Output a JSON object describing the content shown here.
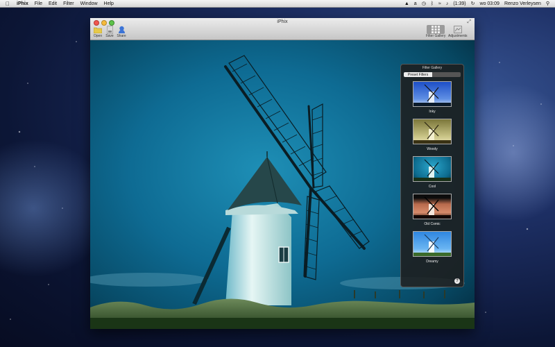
{
  "menubar": {
    "app_name": "iPhix",
    "items": [
      "File",
      "Edit",
      "Filter",
      "Window",
      "Help"
    ],
    "battery": "(1:39)",
    "clock": "wo 03:09",
    "user": "Renzo Verleysen"
  },
  "window": {
    "title": "iPhix",
    "toolbar": {
      "open_label": "Open",
      "save_label": "Save",
      "share_label": "Share",
      "gallery_label": "Filter Gallery",
      "adjust_label": "Adjustments"
    }
  },
  "panel": {
    "title": "Filter Gallery",
    "tab_active": "Preset Filters",
    "tab_inactive": "",
    "filters": [
      {
        "name": "Inky",
        "tint": "#2a5bd0"
      },
      {
        "name": "Woody",
        "tint": "#8a7f3a"
      },
      {
        "name": "Cool",
        "tint": "#1a8fb5"
      },
      {
        "name": "Old Comic",
        "tint": "#b3674a"
      },
      {
        "name": "Dreamy",
        "tint": "#3a98e6"
      }
    ],
    "help": "?"
  },
  "colors": {
    "accent_close": "#f2574f",
    "accent_min": "#f6bb3c",
    "accent_max": "#5fc34b"
  }
}
